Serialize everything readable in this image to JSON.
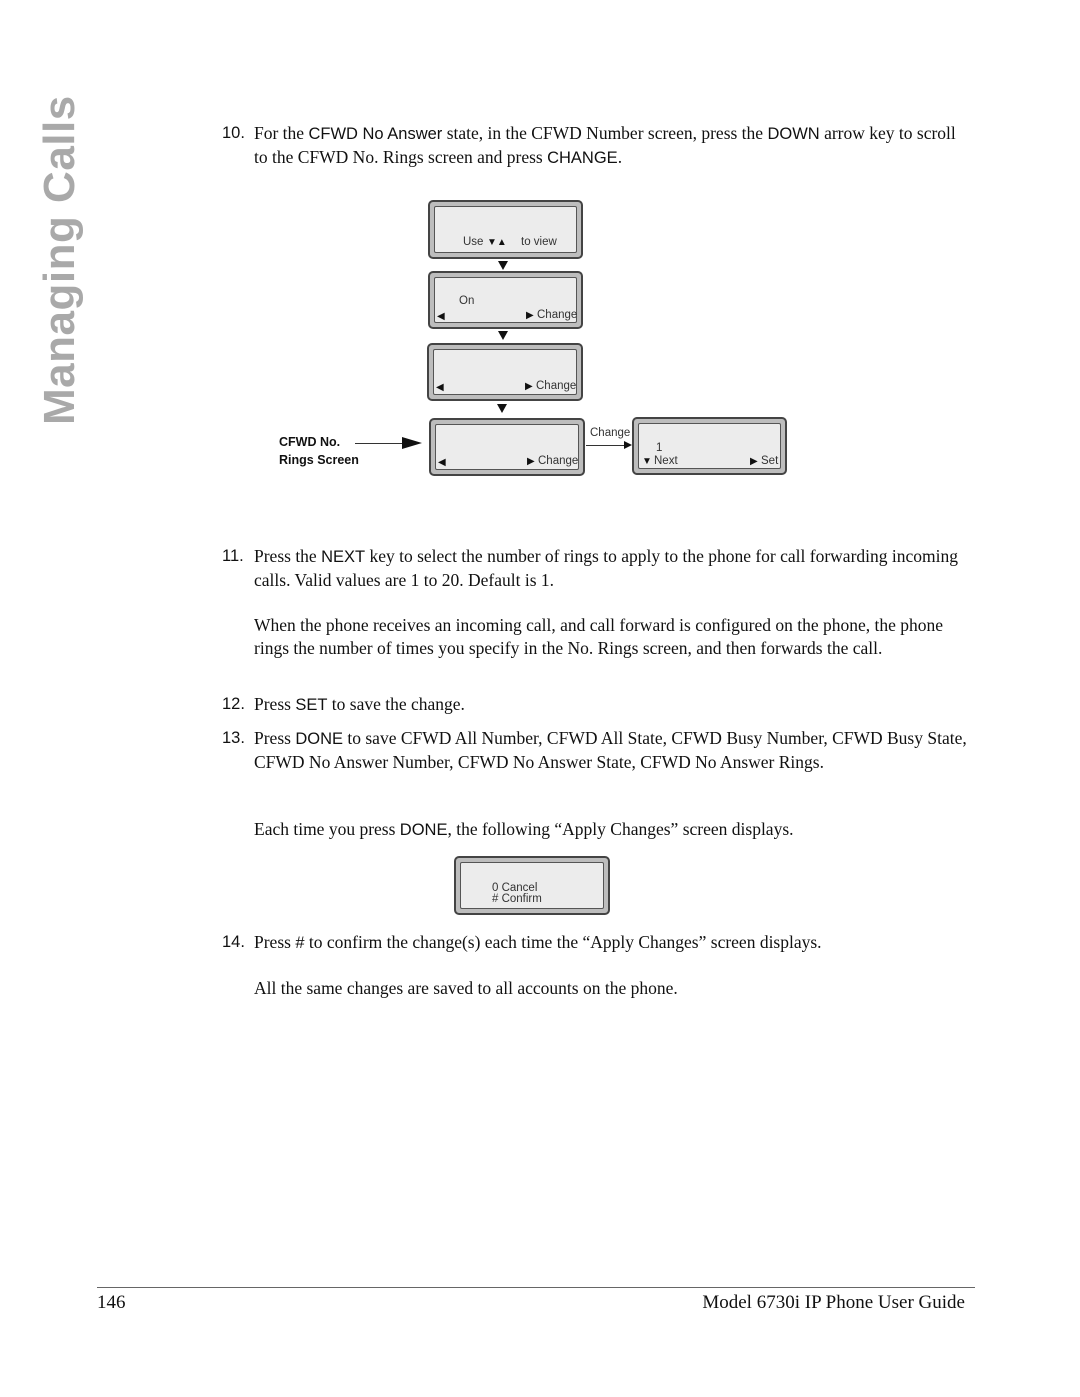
{
  "section_tab": "Managing Calls",
  "steps": {
    "s10": {
      "number": "10.",
      "parts": [
        "For the ",
        "CFWD No Answer",
        " state, in the CFWD Number screen, press the ",
        "DOWN",
        " arrow key to scroll to the CFWD No. Rings screen and press ",
        "CHANGE",
        "."
      ]
    },
    "s11": {
      "number": "11.",
      "parts": [
        "Press the ",
        "NEXT",
        " key to select the number of rings to apply to the phone for call forwarding incoming calls. Valid values are 1 to 20. Default is 1."
      ],
      "note": "When the phone receives an incoming call, and call forward is configured on the phone, the phone rings the number of times you specify in the No. Rings screen, and then forwards the call."
    },
    "s12": {
      "number": "12.",
      "parts": [
        "Press ",
        "SET",
        " to save the change."
      ]
    },
    "s13": {
      "number": "13.",
      "parts": [
        "Press ",
        "DONE",
        " to save CFWD All Number, CFWD All State, CFWD Busy Number, CFWD Busy State, CFWD No Answer Number, CFWD No Answer State, CFWD No Answer Rings."
      ],
      "note_parts": [
        "Each time you press ",
        "DONE",
        ", the following “Apply Changes” screen displays."
      ]
    },
    "s14": {
      "number": "14.",
      "parts": [
        "Press ",
        "#",
        " to confirm the change(s) each time the “Apply Changes” screen displays."
      ],
      "note": "All the same changes are saved to all accounts on the phone."
    }
  },
  "diagram": {
    "screen1": {
      "text_use": "Use",
      "arrows": "▼▲",
      "text_view": "to view"
    },
    "screen2": {
      "value": "On",
      "left": "◀",
      "right": "▶",
      "action": "Change"
    },
    "screen3": {
      "left": "◀",
      "right": "▶",
      "action": "Change"
    },
    "screen4": {
      "left": "◀",
      "right": "▶",
      "action": "Change"
    },
    "screen5": {
      "value": "1",
      "down": "▼",
      "next": "Next",
      "right": "▶",
      "set": "Set"
    },
    "callout_line1": "CFWD No.",
    "callout_line2": "Rings Screen",
    "transition_label": "Change"
  },
  "apply_screen": {
    "line1": "0 Cancel",
    "line2": "# Confirm"
  },
  "footer": {
    "page_number": "146",
    "title": "Model 6730i IP Phone User Guide"
  }
}
